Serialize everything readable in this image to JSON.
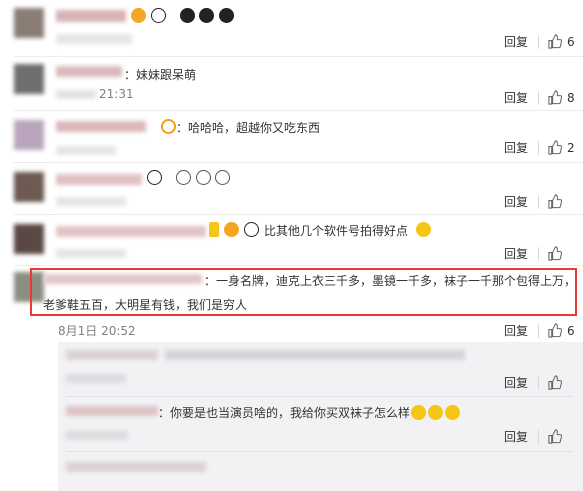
{
  "actions": {
    "reply_label": "回复"
  },
  "comments": [
    {
      "text": "",
      "likes": "6"
    },
    {
      "text": "：妹妹跟呆萌",
      "time": "21:31",
      "likes": "8"
    },
    {
      "text": "：哈哈哈，超越你又吃东西",
      "likes": "2"
    },
    {
      "text": "",
      "likes": ""
    },
    {
      "text": "比其他几个软件号拍得好点",
      "likes": ""
    },
    {
      "text_line1": "：一身名牌，迪克上衣三千多，墨镜一千多，袜子一千那个包得上万，",
      "text_line2": "老爹鞋五百，大明星有钱，我们是穷人",
      "time": "8月1日 20:52",
      "likes": "6"
    }
  ],
  "replies": [
    {
      "text": "",
      "likes": ""
    },
    {
      "text": "：你要是也当演员啥的，我给你买双袜子怎么样",
      "likes": ""
    }
  ],
  "icons": [
    "thumbs-up-icon",
    "panda-emoji-icon",
    "laugh-cry-emoji-icon",
    "clock-emoji-icon"
  ],
  "colors": {
    "highlight_border": "#e83a37",
    "reply_panel_bg": "#f2f2f5",
    "time_color": "#808080"
  }
}
